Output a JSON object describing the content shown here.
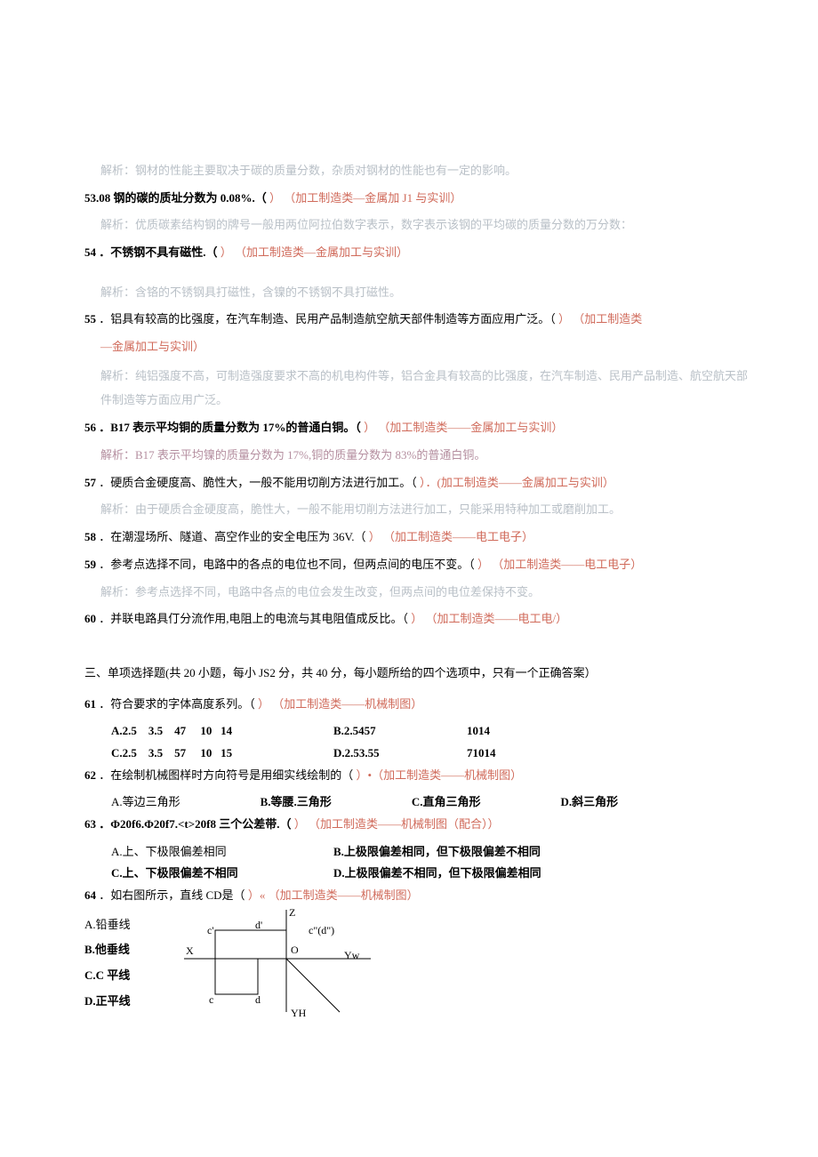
{
  "ex52": "解析：钢材的性能主要取决于碳的质量分数，杂质对钢材的性能也有一定的影响。",
  "q53": {
    "text_b": "53.08 钢的碳的质址分数为 0.08%.（",
    "text_a": "） （加工制造类—金属加 J1 与实训）",
    "ex": "解析：优质碳素结构钢的牌号一般用两位阿拉伯数字表示，数字表示该钢的平均碳的质量分数的万分数："
  },
  "q54": {
    "num": "54",
    "text_b": "．不锈钢不具有磁性.（",
    "tag": "）  （加工制造类—金属加工与实训）",
    "ex": "解析：含铬的不锈钢具打磁性，含镍的不锈钢不具打磁性。"
  },
  "q55": {
    "num": "55",
    "text": "．铝具有较高的比强度，在汽车制造、民用产品制造航空航天部件制造等方面应用广泛。（",
    "tag": "）  （加工制造类",
    "cont": "—金属加工与实训）",
    "ex": "解析：纯铝强度不高，可制造强度要求不高的机电构件等，铝合金具有较高的比强度，在汽车制造、民用产品制造、航空航天部件制造等方面应用广泛。"
  },
  "q56": {
    "num": "56",
    "text_b": "．B17 表示平均铜的质量分数为 17%的普通白铜。（",
    "tag": "）  （加工制造类——金属加工与实训）",
    "ex": "解析：B17 表示平均镍的质量分数为 17%,铜的质量分数为 83%的普通白铜。"
  },
  "q57": {
    "num": "57",
    "text_b": "．硬质合金硬度高、脆性大，一般不能用切削方法进行加工。（",
    "tag": "）．(加工制造类——金属加工与实训）",
    "ex": "解析：由于硬质合金硬度高，脆性大，一般不能用切削方法进行加工，只能采用特种加工或磨削加工。"
  },
  "q58": {
    "num": "58",
    "text_b": "．在潮湿场所、隧道、高空作业的安全电压为 36V.（",
    "tag": "）  （加工制造类——电工电子）"
  },
  "q59": {
    "num": "59",
    "text_b": "．参考点选择不同，电路中的各点的电位也不同，但两点间的电压不变。（",
    "tag": "）  （加工制造类——电工电子）",
    "ex": "解析：参考点选择不同，电路中各点的电位会发生改变，但两点间的电位差保持不变。"
  },
  "q60": {
    "num": "60",
    "text_b": "．并联电路具仃分流作用,电阻上的电流与其电阻值成反比。（",
    "tag": "）  （加工制造类——电工电/）"
  },
  "section": "三、单项选择题(共 20 小题，每小 JS2 分，共 40 分，每小题所给的四个选项中，只有一个正确答案）",
  "q61": {
    "num": "61",
    "text_b": "．符合要求的字体高度系列。（",
    "tag": "）  （加工制造类——机械制图）",
    "optA": "A.2.5    3.5    47     10   14",
    "optB": "B.2.5457",
    "optBnum": "1014",
    "optC": "C.2.5    3.5    57     10   15",
    "optD": "D.2.53.55",
    "optDnum": "71014"
  },
  "q62": {
    "num": "62",
    "text_b": "．在绘制机械图样时方向符号是用细实线绘制的（",
    "tag": "）•（加工制造类——机械制图）",
    "A": "A.等边三角形",
    "B": "B.等腰.三角形",
    "C": "C.直角三角形",
    "D": "D.斜三角形"
  },
  "q63": {
    "num": "63",
    "text_b": "．Φ20f6.Φ20f7.<t>20f8 三个公差带.（",
    "tag": "）  （加工制造类——机械制图（配合））",
    "A": "A.上、下极限偏差相同",
    "B": "B.上极限偏差相同，但下极限偏差不相同",
    "C": "C.上、下极限偏差不相同",
    "D": "D.上极限偏差不相同，但下极限偏差相同"
  },
  "q64": {
    "num": "64",
    "text_b": "．如右图所示，直线 CD是（",
    "tag": "）«   （加工制造类——机械制图）",
    "A": "A.铅垂线",
    "B": "B.他垂线",
    "C": "C.C 平线",
    "D": "D.正平线"
  },
  "fig": {
    "X": "X",
    "Z": "Z",
    "Yw": "Yw",
    "Yh": "YH",
    "c": "c",
    "d": "d",
    "cp": "c'",
    "dp": "d'",
    "cdpp": "c\"(d\")",
    "O": "O"
  }
}
